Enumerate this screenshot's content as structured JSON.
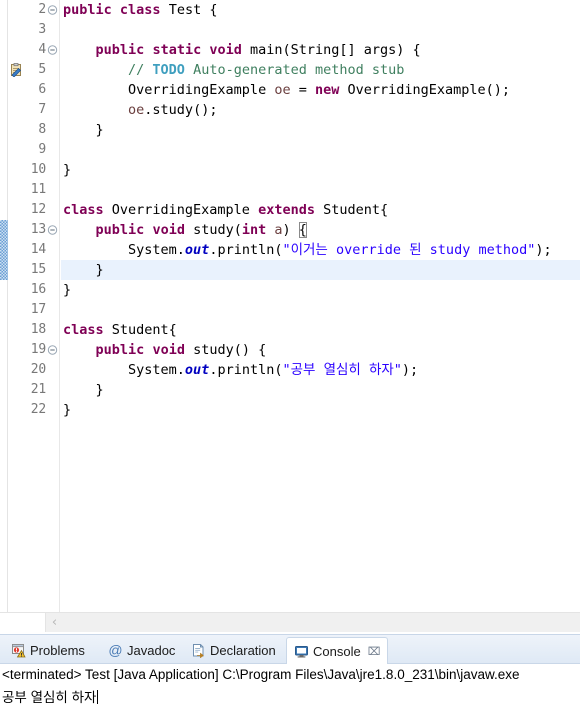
{
  "editor": {
    "name": "java-source-editor",
    "first_visible_line": 2,
    "current_line": 15,
    "lines": [
      {
        "n": "2",
        "fold": "collapse",
        "marker": "",
        "change": false,
        "current": false
      },
      {
        "n": "3",
        "fold": "",
        "marker": "",
        "change": false,
        "current": false
      },
      {
        "n": "4",
        "fold": "collapse",
        "marker": "",
        "change": false,
        "current": false
      },
      {
        "n": "5",
        "fold": "",
        "marker": "todo",
        "change": false,
        "current": false
      },
      {
        "n": "6",
        "fold": "",
        "marker": "",
        "change": false,
        "current": false
      },
      {
        "n": "7",
        "fold": "",
        "marker": "",
        "change": false,
        "current": false
      },
      {
        "n": "8",
        "fold": "",
        "marker": "",
        "change": false,
        "current": false
      },
      {
        "n": "9",
        "fold": "",
        "marker": "",
        "change": false,
        "current": false
      },
      {
        "n": "10",
        "fold": "",
        "marker": "",
        "change": false,
        "current": false
      },
      {
        "n": "11",
        "fold": "",
        "marker": "",
        "change": false,
        "current": false
      },
      {
        "n": "12",
        "fold": "",
        "marker": "",
        "change": false,
        "current": false
      },
      {
        "n": "13",
        "fold": "collapse",
        "marker": "",
        "change": true,
        "current": false
      },
      {
        "n": "14",
        "fold": "",
        "marker": "",
        "change": true,
        "current": false
      },
      {
        "n": "15",
        "fold": "",
        "marker": "",
        "change": true,
        "current": true
      },
      {
        "n": "16",
        "fold": "",
        "marker": "",
        "change": false,
        "current": false
      },
      {
        "n": "17",
        "fold": "",
        "marker": "",
        "change": false,
        "current": false
      },
      {
        "n": "18",
        "fold": "",
        "marker": "",
        "change": false,
        "current": false
      },
      {
        "n": "19",
        "fold": "collapse",
        "marker": "",
        "change": false,
        "current": false
      },
      {
        "n": "20",
        "fold": "",
        "marker": "",
        "change": false,
        "current": false
      },
      {
        "n": "21",
        "fold": "",
        "marker": "",
        "change": false,
        "current": false
      },
      {
        "n": "22",
        "fold": "",
        "marker": "",
        "change": false,
        "current": false
      }
    ],
    "code_text": [
      "public class Test {",
      "",
      "    public static void main(String[] args) {",
      "        // TODO Auto-generated method stub",
      "        OverridingExample oe = new OverridingExample();",
      "        oe.study();",
      "    }",
      "",
      "}",
      "",
      "class OverridingExample extends Student{",
      "    public void study(int a) {",
      "        System.out.println(\"이거는 override 된 study method\");",
      "    }",
      "}",
      "",
      "class Student{",
      "    public void study() {",
      "        System.out.println(\"공부 열심히 하자\");",
      "    }",
      "}"
    ],
    "strings": {
      "line14_string": "\"이거는 override 된 study method\"",
      "line20_string": "\"공부 열심히 하자\""
    },
    "scroll": {
      "left_arrow": "‹"
    }
  },
  "bottom_panel": {
    "tabs": [
      {
        "label": "Problems",
        "icon": "problems-icon",
        "active": false,
        "closable": false
      },
      {
        "label": "Javadoc",
        "icon": "javadoc-icon",
        "active": false,
        "closable": false
      },
      {
        "label": "Declaration",
        "icon": "declaration-icon",
        "active": false,
        "closable": false
      },
      {
        "label": "Console",
        "icon": "console-icon",
        "active": true,
        "closable": true
      }
    ],
    "close_glyph": "⌧",
    "console": {
      "status_line": "<terminated> Test [Java Application] C:\\Program Files\\Java\\jre1.8.0_231\\bin\\javaw.exe",
      "output_line": "공부 열심히 하자"
    }
  },
  "colors": {
    "keyword": "#7F0055",
    "comment": "#3F7F5F",
    "todo": "#3F9FBF",
    "string": "#2A00FF",
    "static_field": "#0000C0",
    "local_var": "#6A3E3E",
    "current_line_bg": "#E9F2FD",
    "change_bar": "#6B9FD4",
    "line_number": "#787878",
    "tab_bar_bg": "#DFE9F5"
  }
}
